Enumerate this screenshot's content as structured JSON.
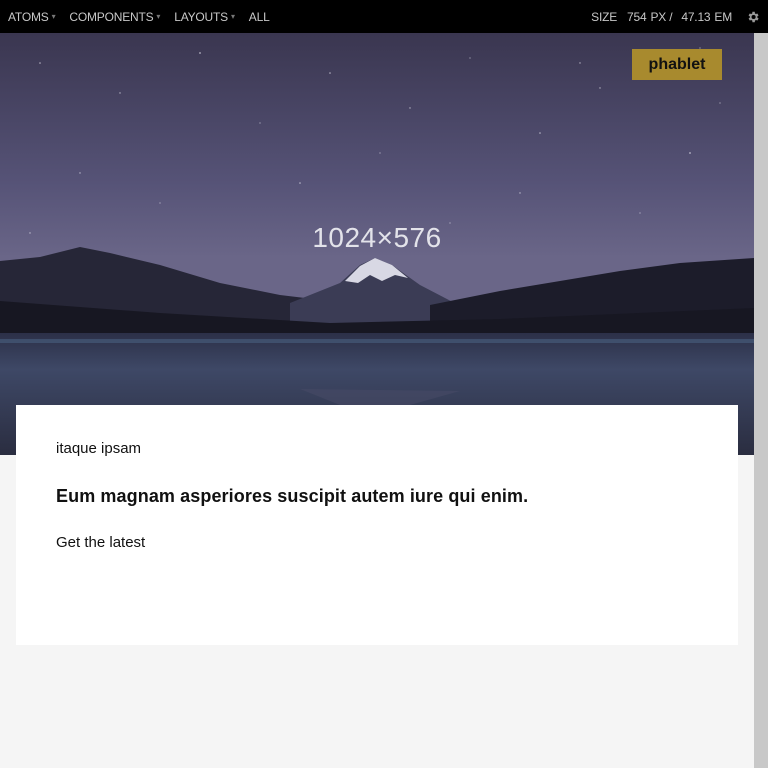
{
  "toolbar": {
    "nav": [
      {
        "label": "ATOMS",
        "dropdown": true
      },
      {
        "label": "COMPONENTS",
        "dropdown": true
      },
      {
        "label": "LAYOUTS",
        "dropdown": true
      },
      {
        "label": "ALL",
        "dropdown": false
      }
    ],
    "caret": "▾",
    "size_label": "SIZE",
    "size_px": "754",
    "size_px_unit": "PX /",
    "size_em": "47.13",
    "size_em_unit": "EM",
    "settings_icon": "gear-icon"
  },
  "hero": {
    "dimensions_text": "1024×576",
    "badge": "phablet",
    "badge_color": "#a88a2e"
  },
  "card": {
    "eyebrow": "itaque ipsam",
    "headline": "Eum magnam asperiores suscipit autem iure qui enim.",
    "cta": "Get the latest"
  }
}
